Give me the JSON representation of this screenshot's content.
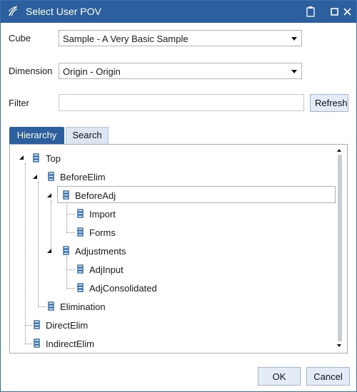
{
  "window": {
    "title": "Select User POV",
    "title_bar_color": "#2c5f9e",
    "icons": [
      "app-logo-icon",
      "clipboard-icon",
      "maximize-icon",
      "close-icon"
    ]
  },
  "form": {
    "cube_label": "Cube",
    "cube_value": "Sample - A Very Basic Sample",
    "dimension_label": "Dimension",
    "dimension_value": "Origin - Origin",
    "filter_label": "Filter",
    "filter_value": "",
    "refresh_label": "Refresh"
  },
  "tabs": [
    {
      "label": "Hierarchy",
      "active": true
    },
    {
      "label": "Search",
      "active": false
    }
  ],
  "tree": {
    "nodes": [
      {
        "label": "Top",
        "level": 0,
        "expanded": true
      },
      {
        "label": "BeforeElim",
        "level": 1,
        "expanded": true
      },
      {
        "label": "BeforeAdj",
        "level": 2,
        "expanded": true,
        "selected": true
      },
      {
        "label": "Import",
        "level": 3
      },
      {
        "label": "Forms",
        "level": 3
      },
      {
        "label": "Adjustments",
        "level": 2,
        "expanded": true
      },
      {
        "label": "AdjInput",
        "level": 3
      },
      {
        "label": "AdjConsolidated",
        "level": 3
      },
      {
        "label": "Elimination",
        "level": 1
      },
      {
        "label": "DirectElim",
        "level": 0
      },
      {
        "label": "IndirectElim",
        "level": 0
      }
    ]
  },
  "footer": {
    "ok_label": "OK",
    "cancel_label": "Cancel"
  }
}
